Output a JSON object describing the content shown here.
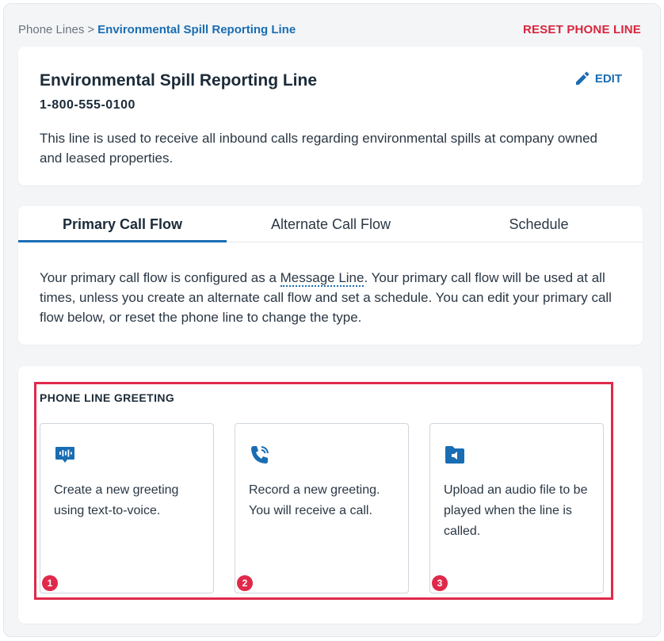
{
  "breadcrumb": {
    "parent": "Phone Lines",
    "separator": ">",
    "current": "Environmental Spill Reporting Line"
  },
  "header": {
    "reset_label": "RESET PHONE LINE"
  },
  "line": {
    "title": "Environmental Spill Reporting Line",
    "number": "1-800-555-0100",
    "description": "This line is used to receive all inbound calls regarding environmental spills at company owned and leased properties.",
    "edit_label": "EDIT"
  },
  "tabs": [
    {
      "label": "Primary Call Flow",
      "active": true
    },
    {
      "label": "Alternate Call Flow",
      "active": false
    },
    {
      "label": "Schedule",
      "active": false
    }
  ],
  "flow": {
    "text_before": "Your primary call flow is configured as a ",
    "link": "Message Line",
    "text_after": ". Your primary call flow will be used at all times, unless you create an alternate call flow and set a schedule. You can edit your primary call flow below, or reset the phone line to change the type."
  },
  "greeting": {
    "title": "PHONE LINE GREETING",
    "options": [
      {
        "icon": "text-to-voice-icon",
        "text": "Create a new greeting using text-to-voice.",
        "badge": "1"
      },
      {
        "icon": "phone-call-icon",
        "text": "Record a new greeting. You will receive a call.",
        "badge": "2"
      },
      {
        "icon": "audio-folder-icon",
        "text": "Upload an audio file to be played when the line is called.",
        "badge": "3"
      }
    ]
  },
  "colors": {
    "accent": "#1a6db3",
    "danger": "#d7263d",
    "highlight": "#e0294a",
    "background": "#f3f5f7"
  }
}
